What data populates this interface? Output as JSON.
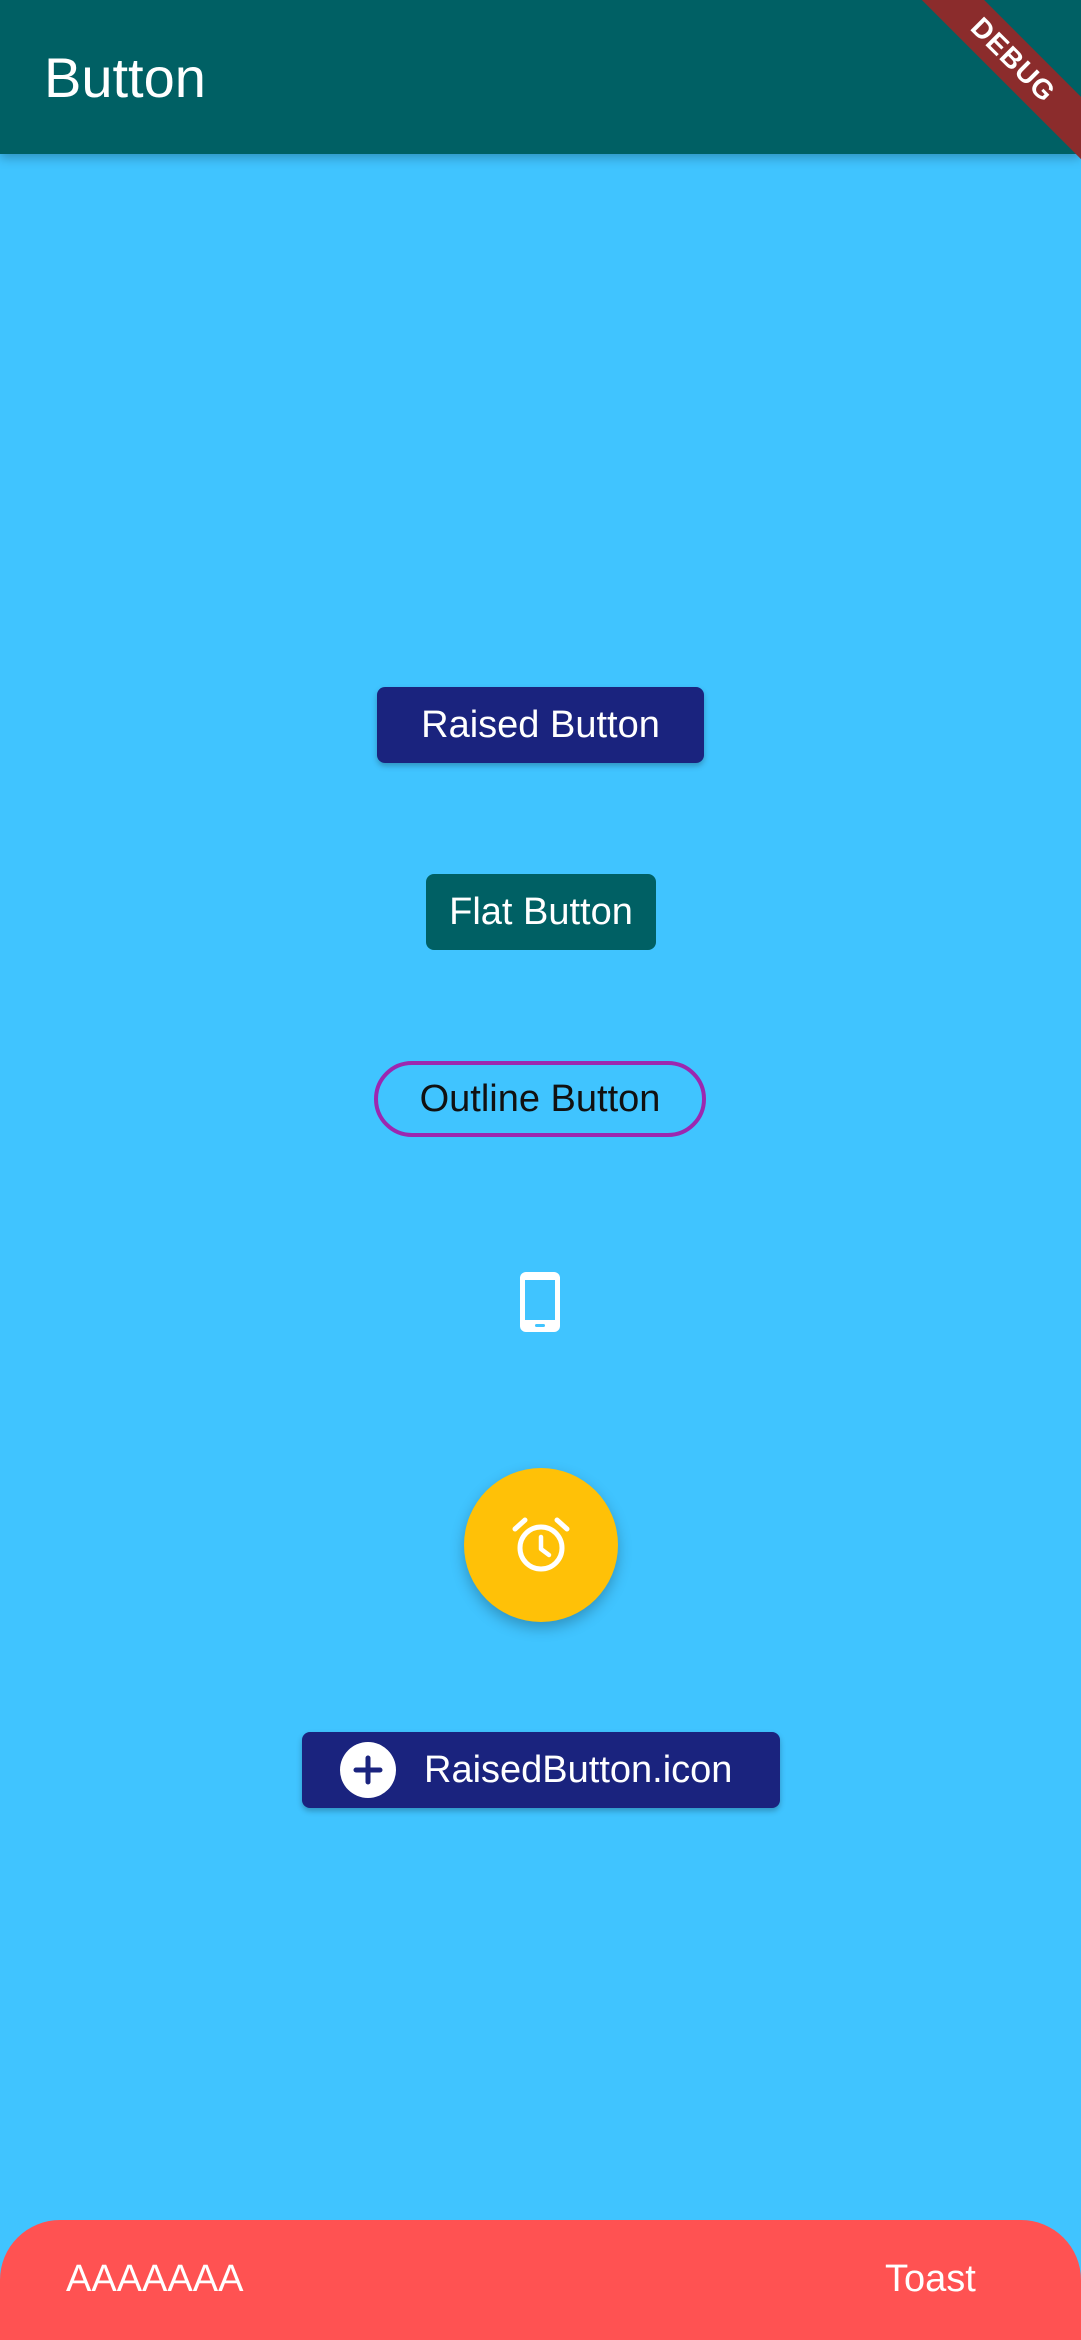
{
  "appbar": {
    "title": "Button"
  },
  "debug_banner": {
    "label": "DEBUG"
  },
  "buttons": {
    "raised_label": "Raised Button",
    "flat_label": "Flat Button",
    "outline_label": "Outline Button",
    "raised_icon_label": "RaisedButton.icon"
  },
  "icons": {
    "icon_button": "phone-icon",
    "fab": "alarm-icon",
    "raised_icon": "add-circle-icon"
  },
  "toast": {
    "message": "AAAAAAA",
    "action_label": "Toast"
  },
  "colors": {
    "appbar": "#006064",
    "background": "#40C4FF",
    "raised": "#1A237E",
    "flat": "#006064",
    "outline_border": "#9C27B0",
    "fab": "#FFC107",
    "toast": "#FF5252",
    "debug": "#8B2C2C"
  }
}
